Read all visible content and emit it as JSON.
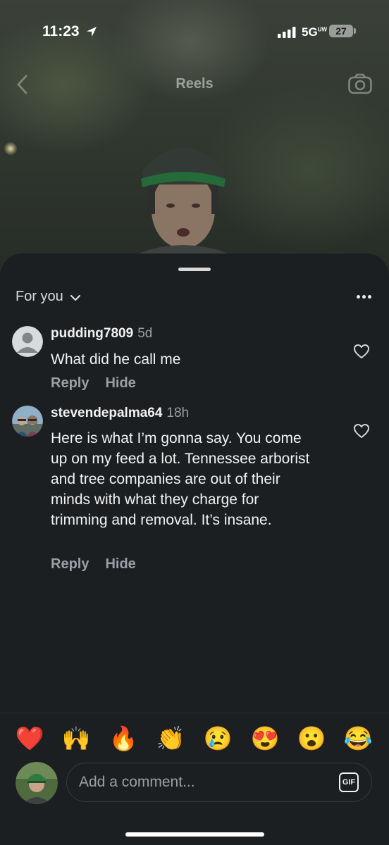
{
  "status_bar": {
    "time": "11:23",
    "network": "5G",
    "network_sub": "UW",
    "battery": "27"
  },
  "top_nav": {
    "title": "Reels",
    "back_icon": "chevron-left-icon",
    "camera_icon": "camera-icon"
  },
  "comments_header": {
    "filter_label": "For you",
    "more_icon": "more-dots-icon"
  },
  "comments": [
    {
      "username": "pudding7809",
      "age": "5d",
      "text": "What did he call me",
      "reply_label": "Reply",
      "hide_label": "Hide",
      "avatar": "default-avatar-icon"
    },
    {
      "username": "stevendepalma64",
      "age": "18h",
      "text": "Here is what I’m gonna say. You come up on my feed a lot. Tennessee arborist and tree companies are out of their minds with what they charge for trimming and removal. It’s insane.",
      "reply_label": "Reply",
      "hide_label": "Hide",
      "avatar": "user-photo-avatar"
    }
  ],
  "emoji_bar": [
    "❤️",
    "🙌",
    "🔥",
    "👏",
    "😢",
    "😍",
    "😮",
    "😂"
  ],
  "composer": {
    "placeholder": "Add a comment...",
    "gif_label": "GIF"
  },
  "colors": {
    "sheet_background": "#1b1f22",
    "secondary_text": "#9aa0a6",
    "primary_text": "#f2f2f2"
  }
}
